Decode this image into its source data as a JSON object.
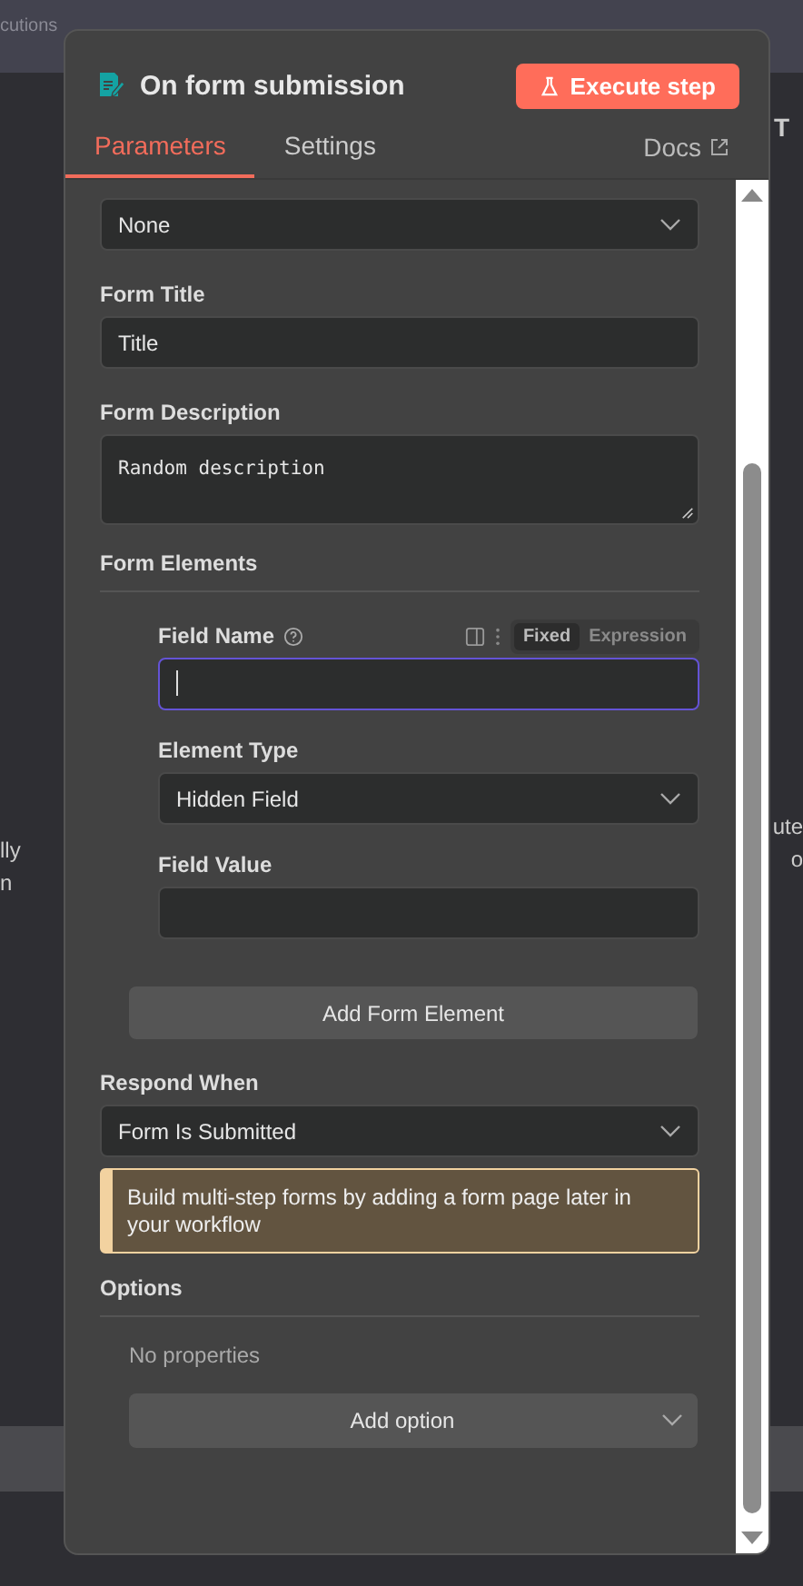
{
  "background": {
    "topbar_text": "cutions",
    "left_texts": [
      "lly",
      "n"
    ],
    "right_texts": [
      "ute",
      "o"
    ],
    "corner_text": "T"
  },
  "panel": {
    "title": "On form submission",
    "execute_button": "Execute step",
    "tabs": [
      {
        "label": "Parameters",
        "selected": true
      },
      {
        "label": "Settings",
        "selected": false
      }
    ],
    "docs_link": "Docs",
    "fields": [
      {
        "kind": "select",
        "value": "None"
      },
      {
        "kind": "input",
        "label": "Form Title",
        "value": "Title"
      },
      {
        "kind": "textarea",
        "label": "Form Description",
        "value": "Random description"
      },
      {
        "kind": "collection",
        "label": "Form Elements",
        "mode_toggle": [
          {
            "label": "Fixed",
            "selected": true
          },
          {
            "label": "Expression",
            "selected": false
          }
        ],
        "items": [
          {
            "kind": "input",
            "label": "Field Name",
            "value": "",
            "focused": true,
            "help": true
          },
          {
            "kind": "select",
            "label": "Element Type",
            "value": "Hidden Field"
          },
          {
            "kind": "input",
            "label": "Field Value",
            "value": ""
          }
        ],
        "add_button": "Add Form Element"
      },
      {
        "kind": "select",
        "label": "Respond When",
        "value": "Form Is Submitted"
      },
      {
        "kind": "notice",
        "text": "Build multi-step forms by adding a form page later in your workflow"
      },
      {
        "kind": "options",
        "label": "Options",
        "empty_text": "No properties",
        "add_button": "Add option"
      }
    ]
  }
}
